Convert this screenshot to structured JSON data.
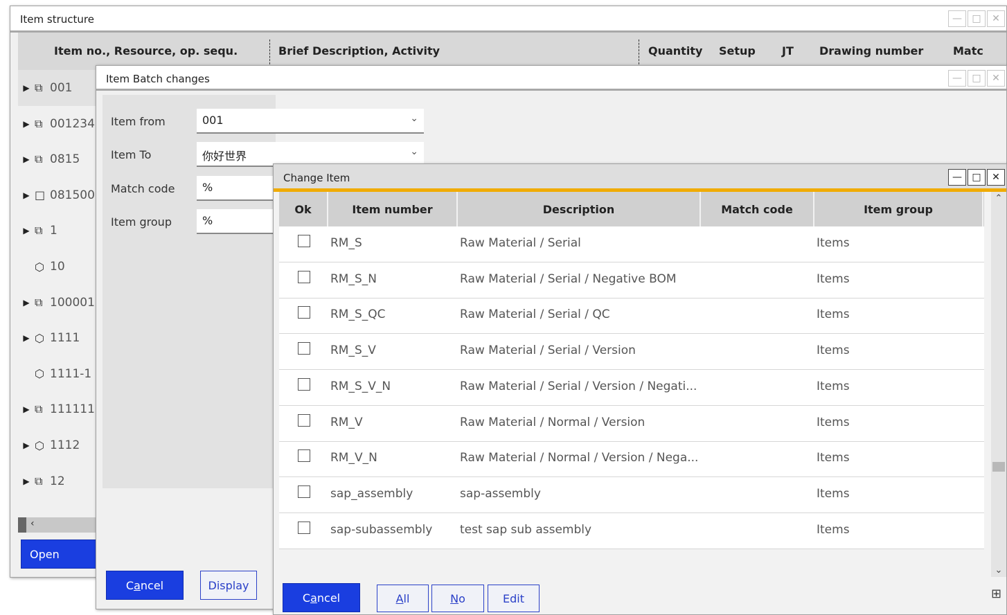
{
  "structure_window": {
    "title": "Item structure",
    "columns": [
      "Item no., Resource, op. sequ.",
      "Brief Description, Activity",
      "Quantity",
      "Setup",
      "JT",
      "Drawing number",
      "Matc"
    ],
    "tree": [
      {
        "label": "001",
        "icon": "⧉",
        "expand": "▶",
        "selected": true
      },
      {
        "label": "001234",
        "icon": "⧉",
        "expand": "▶"
      },
      {
        "label": "0815",
        "icon": "⧉",
        "expand": "▶"
      },
      {
        "label": "081500",
        "icon": "□",
        "expand": "▶"
      },
      {
        "label": "1",
        "icon": "⧉",
        "expand": "▶"
      },
      {
        "label": "10",
        "icon": "⬡",
        "expand": ""
      },
      {
        "label": "100001",
        "icon": "⧉",
        "expand": "▶"
      },
      {
        "label": "1111",
        "icon": "⬡",
        "expand": "▶"
      },
      {
        "label": "1111-1",
        "icon": "⬡",
        "expand": ""
      },
      {
        "label": "111111",
        "icon": "⧉",
        "expand": "▶"
      },
      {
        "label": "1112",
        "icon": "⬡",
        "expand": "▶"
      },
      {
        "label": "12",
        "icon": "⧉",
        "expand": "▶"
      }
    ],
    "open_button": "Open"
  },
  "batch_window": {
    "title": "Item Batch changes",
    "fields": [
      {
        "label": "Item from",
        "value": "001",
        "dropdown": true
      },
      {
        "label": "Item To",
        "value": "你好世界",
        "dropdown": true
      },
      {
        "label": "Match code",
        "value": "%",
        "dropdown": false
      },
      {
        "label": "Item group",
        "value": "%",
        "dropdown": false
      }
    ],
    "cancel_pre": "C",
    "cancel_ul": "a",
    "cancel_post": "ncel",
    "display_button": "Display"
  },
  "change_window": {
    "title": "Change Item",
    "columns": [
      "Ok",
      "Item number",
      "Description",
      "Match code",
      "Item group"
    ],
    "rows": [
      {
        "item": "RM_S",
        "desc": "Raw Material / Serial",
        "match": "",
        "group": "Items"
      },
      {
        "item": "RM_S_N",
        "desc": "Raw Material / Serial / Negative BOM",
        "match": "",
        "group": "Items"
      },
      {
        "item": "RM_S_QC",
        "desc": "Raw Material / Serial / QC",
        "match": "",
        "group": "Items"
      },
      {
        "item": "RM_S_V",
        "desc": "Raw Material / Serial / Version",
        "match": "",
        "group": "Items"
      },
      {
        "item": "RM_S_V_N",
        "desc": "Raw Material / Serial / Version / Negati...",
        "match": "",
        "group": "Items"
      },
      {
        "item": "RM_V",
        "desc": "Raw Material / Normal / Version",
        "match": "",
        "group": "Items"
      },
      {
        "item": "RM_V_N",
        "desc": "Raw Material / Normal / Version / Nega...",
        "match": "",
        "group": "Items"
      },
      {
        "item": "sap_assembly",
        "desc": "sap-assembly",
        "match": "",
        "group": "Items"
      },
      {
        "item": "sap-subassembly",
        "desc": "test sap sub assembly",
        "match": "",
        "group": "Items"
      }
    ],
    "cancel_pre": "C",
    "cancel_ul": "a",
    "cancel_post": "ncel",
    "all_ul": "A",
    "all_post": "ll",
    "no_ul": "N",
    "no_post": "o",
    "edit_button": "Edit"
  },
  "glyphs": {
    "minimize": "—",
    "maximize": "□",
    "close": "✕",
    "chevron_down": "⌄",
    "chevron_up": "⌃",
    "chevron_left": "‹",
    "layout": "⊞"
  },
  "colors": {
    "accent": "#f0ab00",
    "primary_button": "#1a3ee0",
    "secondary_border": "#2a40c8"
  }
}
